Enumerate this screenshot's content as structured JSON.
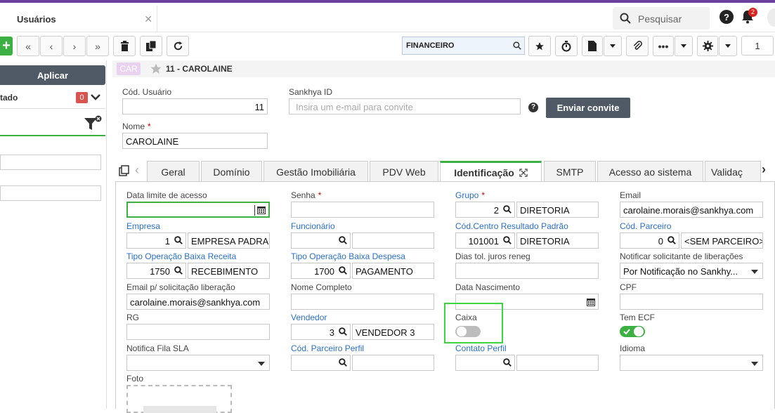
{
  "app": {
    "tab_title": "Usuários",
    "search_placeholder": "Pesquisar",
    "notif_count": "2"
  },
  "toolbar": {
    "module": "FINANCEIRO",
    "page": "1"
  },
  "left": {
    "apply": "Aplicar",
    "filter_label": "tado",
    "filter_count": "0"
  },
  "record": {
    "badge": "CAR",
    "title": "11 - CAROLAINE"
  },
  "form": {
    "cod_usuario_label": "Cód. Usuário",
    "cod_usuario": "11",
    "sankhya_id_label": "Sankhya ID",
    "sankhya_id_placeholder": "Insira um e-mail para convite",
    "enviar_convite": "Enviar convite",
    "nome_label": "Nome",
    "nome": "CAROLAINE"
  },
  "tabs": [
    "Geral",
    "Domínio",
    "Gestão Imobiliária",
    "PDV Web",
    "Identificação",
    "SMTP",
    "Acesso ao sistema",
    "Validaç"
  ],
  "fields": {
    "data_limite": "Data limite de acesso",
    "senha": "Senha",
    "grupo": "Grupo",
    "grupo_code": "2",
    "grupo_name": "DIRETORIA",
    "email": "Email",
    "email_value": "carolaine.morais@sankhya.com",
    "empresa": "Empresa",
    "empresa_code": "1",
    "empresa_name": "EMPRESA PADRA",
    "funcionario": "Funcionário",
    "cod_cr": "Cód.Centro Resultado Padrão",
    "cod_cr_code": "101001",
    "cod_cr_name": "DIRETORIA",
    "cod_parceiro": "Cód. Parceiro",
    "cod_parceiro_code": "0",
    "cod_parceiro_name": "<SEM PARCEIRO>",
    "top_receita": "Tipo Operação Baixa Receita",
    "top_receita_code": "1750",
    "top_receita_name": "RECEBIMENTO",
    "top_despesa": "Tipo Operação Baixa Despesa",
    "top_despesa_code": "1700",
    "top_despesa_name": "PAGAMENTO",
    "dias_tol": "Dias tol. juros reneg",
    "notificar": "Notificar solicitante de liberações",
    "notificar_value": "Por Notificação no Sankhy...",
    "email_lib": "Email p/ solicitação liberação",
    "email_lib_value": "carolaine.morais@sankhya.com",
    "nome_completo": "Nome Completo",
    "data_nasc": "Data Nascimento",
    "cpf": "CPF",
    "rg": "RG",
    "vendedor": "Vendedor",
    "vendedor_code": "3",
    "vendedor_name": "VENDEDOR 3",
    "caixa": "Caixa",
    "tem_ecf": "Tem ECF",
    "notifica_fila": "Notifica Fila SLA",
    "cod_parc_perfil": "Cód. Parceiro Perfil",
    "contato_perfil": "Contato Perfil",
    "idioma": "Idioma",
    "foto": "Foto"
  },
  "colors": {
    "accent": "#3cb043",
    "link": "#2a6fc9",
    "dark_button": "#4f5a66",
    "top_bar": "#6b3fa0"
  }
}
